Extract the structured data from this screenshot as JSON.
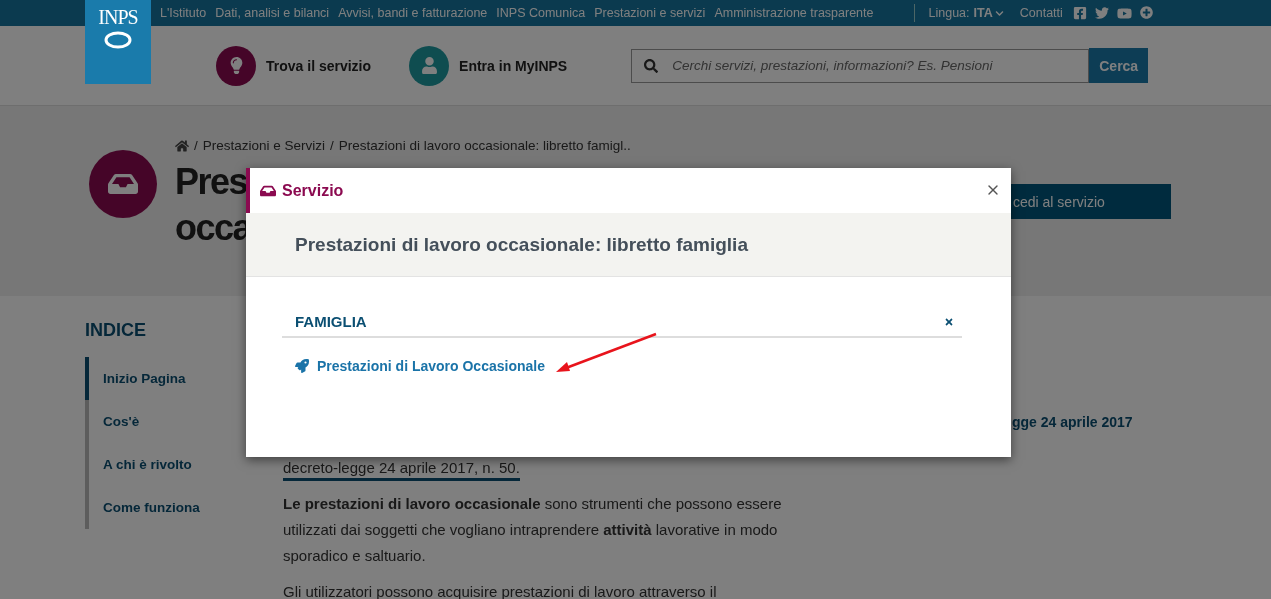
{
  "top_bar": {
    "logo": "INPS",
    "nav": [
      "L'Istituto",
      "Dati, analisi e bilanci",
      "Avvisi, bandi e fatturazione",
      "INPS Comunica",
      "Prestazioni e servizi",
      "Amministrazione trasparente"
    ],
    "language_label": "Lingua:",
    "language": "ITA",
    "contacts": "Contatti"
  },
  "header": {
    "actions": [
      {
        "label": "Trova il servizio",
        "kind": "lightbulb"
      },
      {
        "label": "Entra in MyINPS",
        "kind": "user"
      }
    ],
    "search": {
      "placeholder": "Cerchi servizi, prestazioni, informazioni? Es. Pensioni"
    },
    "search_button": "Cerca"
  },
  "breadcrumb": {
    "separator": "/",
    "items": [
      "Prestazioni e Servizi",
      "Prestazioni di lavoro occasionale: libretto famigl.."
    ]
  },
  "hero": {
    "title_lines": [
      "Pres",
      "occa"
    ],
    "action_button": "cedi al servizio"
  },
  "index": {
    "heading": "INDICE",
    "items": [
      {
        "label": "Inizio Pagina",
        "selected": true
      },
      {
        "label": "Cos'è",
        "selected": false
      },
      {
        "label": "A chi è rivolto",
        "selected": false
      },
      {
        "label": "Come funziona",
        "selected": false
      }
    ]
  },
  "content": {
    "lead_link": "decreto-legge 24 aprile 2017, n. 50.",
    "paragraphs": [
      "**Le prestazioni di lavoro occasionale** sono strumenti che possono essere utilizzati dai soggetti che vogliano intraprendere **attività** lavorative in modo sporadico e saltuario.",
      "Gli utilizzatori possono acquisire prestazioni di lavoro attraverso il"
    ],
    "side_text": "gge 24 aprile 2017"
  },
  "modal": {
    "header": "Servizio",
    "title": "Prestazioni di lavoro occasionale: libretto famiglia",
    "category": "FAMIGLIA",
    "links": [
      "Prestazioni di Lavoro Occasionale"
    ]
  }
}
